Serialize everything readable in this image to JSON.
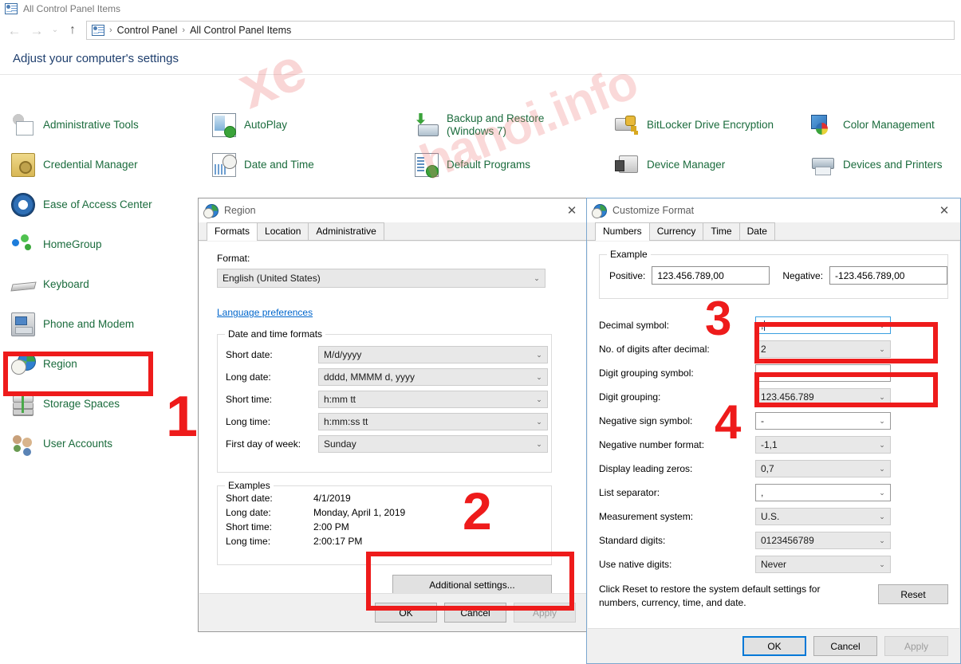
{
  "window": {
    "title": "All Control Panel Items",
    "titlebar_icon": "control-panel-icon"
  },
  "navigation": {
    "back_icon": "←",
    "forward_icon": "→",
    "recent_icon": "⌄",
    "up_icon": "↑",
    "breadcrumb": {
      "icon": "control-panel-icon",
      "separator": "›",
      "parts": [
        "Control Panel",
        "All Control Panel Items"
      ]
    }
  },
  "header": {
    "title": "Adjust your computer's settings"
  },
  "watermark": {
    "text1": "xe",
    "text2": "hanoi.info"
  },
  "control_panel_items": [
    {
      "label": "Administrative Tools",
      "icon": "administrative-tools-icon",
      "col": 1,
      "row": 1
    },
    {
      "label": "AutoPlay",
      "icon": "autoplay-icon",
      "col": 2,
      "row": 1
    },
    {
      "label": "Backup and Restore (Windows 7)",
      "icon": "backup-restore-icon",
      "col": 3,
      "row": 1
    },
    {
      "label": "BitLocker Drive Encryption",
      "icon": "bitlocker-icon",
      "col": 4,
      "row": 1
    },
    {
      "label": "Color Management",
      "icon": "color-management-icon",
      "col": 5,
      "row": 1
    },
    {
      "label": "Credential Manager",
      "icon": "credential-manager-icon",
      "col": 1,
      "row": 2
    },
    {
      "label": "Date and Time",
      "icon": "date-time-icon",
      "col": 2,
      "row": 2
    },
    {
      "label": "Default Programs",
      "icon": "default-programs-icon",
      "col": 3,
      "row": 2
    },
    {
      "label": "Device Manager",
      "icon": "device-manager-icon",
      "col": 4,
      "row": 2
    },
    {
      "label": "Devices and Printers",
      "icon": "devices-printers-icon",
      "col": 5,
      "row": 2
    },
    {
      "label": "Ease of Access Center",
      "icon": "ease-of-access-icon",
      "col": 1,
      "row": 3
    },
    {
      "label": "HomeGroup",
      "icon": "homegroup-icon",
      "col": 1,
      "row": 4
    },
    {
      "label": "Keyboard",
      "icon": "keyboard-icon",
      "col": 1,
      "row": 5
    },
    {
      "label": "Phone and Modem",
      "icon": "phone-modem-icon",
      "col": 1,
      "row": 6
    },
    {
      "label": "Region",
      "icon": "region-icon",
      "col": 1,
      "row": 7
    },
    {
      "label": "Storage Spaces",
      "icon": "storage-spaces-icon",
      "col": 1,
      "row": 8
    },
    {
      "label": "User Accounts",
      "icon": "user-accounts-icon",
      "col": 1,
      "row": 9
    }
  ],
  "region_dialog": {
    "title": "Region",
    "close_label": "✕",
    "tabs": [
      {
        "label": "Formats",
        "active": true
      },
      {
        "label": "Location",
        "active": false
      },
      {
        "label": "Administrative",
        "active": false
      }
    ],
    "format_label": "Format:",
    "format_value": "English (United States)",
    "language_preferences_link": "Language preferences",
    "datetime_group_label": "Date and time formats",
    "datetime_fields": [
      {
        "label": "Short date:",
        "value": "M/d/yyyy"
      },
      {
        "label": "Long date:",
        "value": "dddd, MMMM d, yyyy"
      },
      {
        "label": "Short time:",
        "value": "h:mm tt"
      },
      {
        "label": "Long time:",
        "value": "h:mm:ss tt"
      },
      {
        "label": "First day of week:",
        "value": "Sunday"
      }
    ],
    "examples_group_label": "Examples",
    "examples": [
      {
        "label": "Short date:",
        "value": "4/1/2019"
      },
      {
        "label": "Long date:",
        "value": "Monday, April 1, 2019"
      },
      {
        "label": "Short time:",
        "value": "2:00 PM"
      },
      {
        "label": "Long time:",
        "value": "2:00:17 PM"
      }
    ],
    "additional_settings_button": "Additional settings...",
    "buttons": {
      "ok": "OK",
      "cancel": "Cancel",
      "apply": "Apply"
    }
  },
  "customize_format_dialog": {
    "title": "Customize Format",
    "close_label": "✕",
    "tabs": [
      {
        "label": "Numbers",
        "active": true
      },
      {
        "label": "Currency",
        "active": false
      },
      {
        "label": "Time",
        "active": false
      },
      {
        "label": "Date",
        "active": false
      }
    ],
    "example_group_label": "Example",
    "positive_label": "Positive:",
    "positive_value": "123.456.789,00",
    "negative_label": "Negative:",
    "negative_value": "-123.456.789,00",
    "fields": [
      {
        "label": "Decimal symbol:",
        "value": ",",
        "state": "focus"
      },
      {
        "label": "No. of digits after decimal:",
        "value": "2",
        "state": "normal"
      },
      {
        "label": "Digit grouping symbol:",
        "value": ".",
        "state": "white"
      },
      {
        "label": "Digit grouping:",
        "value": "123.456.789",
        "state": "normal"
      },
      {
        "label": "Negative sign symbol:",
        "value": "-",
        "state": "white"
      },
      {
        "label": "Negative number format:",
        "value": "-1,1",
        "state": "normal"
      },
      {
        "label": "Display leading zeros:",
        "value": "0,7",
        "state": "normal"
      },
      {
        "label": "List separator:",
        "value": ",",
        "state": "white"
      },
      {
        "label": "Measurement system:",
        "value": "U.S.",
        "state": "normal"
      },
      {
        "label": "Standard digits:",
        "value": "0123456789",
        "state": "normal"
      },
      {
        "label": "Use native digits:",
        "value": "Never",
        "state": "normal"
      }
    ],
    "reset_note_line1": "Click Reset to restore the system default settings for",
    "reset_note_line2": "numbers, currency, time, and date.",
    "reset_button": "Reset",
    "buttons": {
      "ok": "OK",
      "cancel": "Cancel",
      "apply": "Apply"
    }
  },
  "annotations": {
    "step1": "1",
    "step2": "2",
    "step3": "3",
    "step4": "4",
    "color": "#ee1b1b"
  }
}
